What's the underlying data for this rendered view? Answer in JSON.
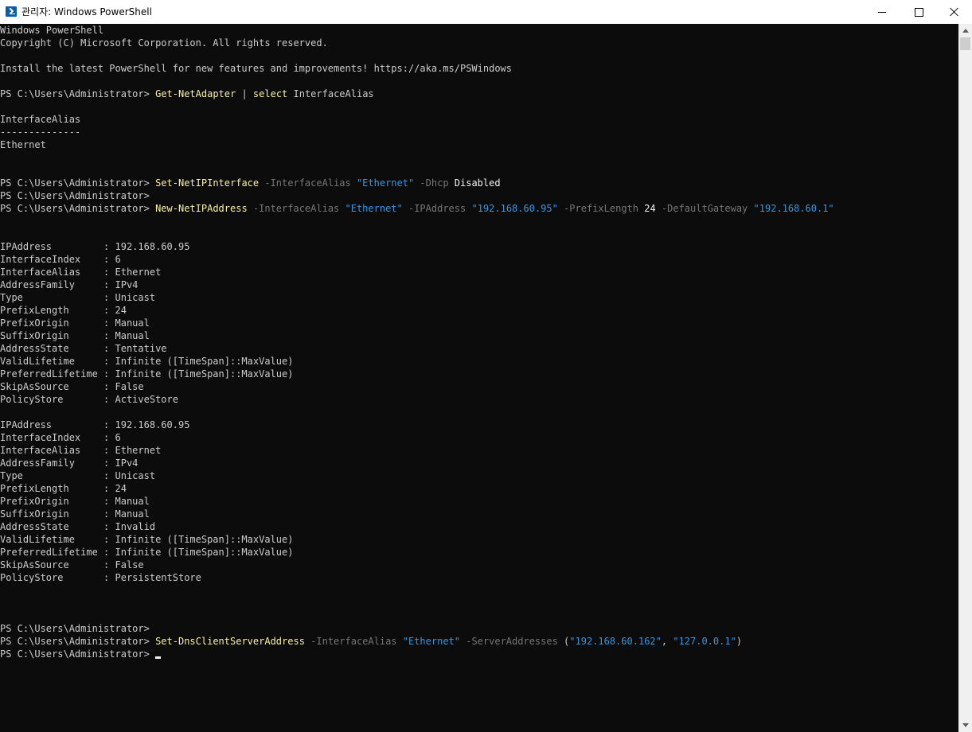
{
  "window": {
    "title": "관리자: Windows PowerShell",
    "icon": "powershell-icon",
    "controls": [
      "minimize-icon",
      "maximize-icon",
      "close-icon"
    ]
  },
  "colors": {
    "background": "#0c0c0c",
    "default_text": "#cccccc",
    "command": "#f9f1a5",
    "parameter": "#767676",
    "string": "#3a96dd",
    "number": "#f2f2f2"
  },
  "console": {
    "lines": [
      [
        {
          "t": "Windows PowerShell",
          "c": "default"
        }
      ],
      [
        {
          "t": "Copyright (C) Microsoft Corporation. All rights reserved.",
          "c": "default"
        }
      ],
      [],
      [
        {
          "t": "Install the latest PowerShell for new features and improvements! https://aka.ms/PSWindows",
          "c": "default"
        }
      ],
      [],
      [
        {
          "t": "PS C:\\Users\\Administrator> ",
          "c": "default"
        },
        {
          "t": "Get-NetAdapter",
          "c": "cmd"
        },
        {
          "t": " | ",
          "c": "op"
        },
        {
          "t": "select",
          "c": "cmd"
        },
        {
          "t": " InterfaceAlias",
          "c": "default"
        }
      ],
      [],
      [
        {
          "t": "InterfaceAlias",
          "c": "default"
        }
      ],
      [
        {
          "t": "--------------",
          "c": "default"
        }
      ],
      [
        {
          "t": "Ethernet",
          "c": "default"
        }
      ],
      [],
      [],
      [
        {
          "t": "PS C:\\Users\\Administrator> ",
          "c": "default"
        },
        {
          "t": "Set-NetIPInterface",
          "c": "cmd"
        },
        {
          "t": " -InterfaceAlias",
          "c": "param"
        },
        {
          "t": " ",
          "c": "default"
        },
        {
          "t": "\"Ethernet\"",
          "c": "str"
        },
        {
          "t": " -Dhcp",
          "c": "param"
        },
        {
          "t": " Disabled",
          "c": "arg"
        }
      ],
      [
        {
          "t": "PS C:\\Users\\Administrator>",
          "c": "default"
        }
      ],
      [
        {
          "t": "PS C:\\Users\\Administrator> ",
          "c": "default"
        },
        {
          "t": "New-NetIPAddress",
          "c": "cmd"
        },
        {
          "t": " -InterfaceAlias",
          "c": "param"
        },
        {
          "t": " ",
          "c": "default"
        },
        {
          "t": "\"Ethernet\"",
          "c": "str"
        },
        {
          "t": " -IPAddress",
          "c": "param"
        },
        {
          "t": " ",
          "c": "default"
        },
        {
          "t": "\"192.168.60.95\"",
          "c": "str"
        },
        {
          "t": " -PrefixLength",
          "c": "param"
        },
        {
          "t": " 24",
          "c": "num"
        },
        {
          "t": " -DefaultGateway",
          "c": "param"
        },
        {
          "t": " ",
          "c": "default"
        },
        {
          "t": "\"192.168.60.1\"",
          "c": "str"
        }
      ],
      [],
      [],
      [
        {
          "t": "IPAddress         : 192.168.60.95",
          "c": "default"
        }
      ],
      [
        {
          "t": "InterfaceIndex    : 6",
          "c": "default"
        }
      ],
      [
        {
          "t": "InterfaceAlias    : Ethernet",
          "c": "default"
        }
      ],
      [
        {
          "t": "AddressFamily     : IPv4",
          "c": "default"
        }
      ],
      [
        {
          "t": "Type              : Unicast",
          "c": "default"
        }
      ],
      [
        {
          "t": "PrefixLength      : 24",
          "c": "default"
        }
      ],
      [
        {
          "t": "PrefixOrigin      : Manual",
          "c": "default"
        }
      ],
      [
        {
          "t": "SuffixOrigin      : Manual",
          "c": "default"
        }
      ],
      [
        {
          "t": "AddressState      : Tentative",
          "c": "default"
        }
      ],
      [
        {
          "t": "ValidLifetime     : Infinite ([TimeSpan]::MaxValue)",
          "c": "default"
        }
      ],
      [
        {
          "t": "PreferredLifetime : Infinite ([TimeSpan]::MaxValue)",
          "c": "default"
        }
      ],
      [
        {
          "t": "SkipAsSource      : False",
          "c": "default"
        }
      ],
      [
        {
          "t": "PolicyStore       : ActiveStore",
          "c": "default"
        }
      ],
      [],
      [
        {
          "t": "IPAddress         : 192.168.60.95",
          "c": "default"
        }
      ],
      [
        {
          "t": "InterfaceIndex    : 6",
          "c": "default"
        }
      ],
      [
        {
          "t": "InterfaceAlias    : Ethernet",
          "c": "default"
        }
      ],
      [
        {
          "t": "AddressFamily     : IPv4",
          "c": "default"
        }
      ],
      [
        {
          "t": "Type              : Unicast",
          "c": "default"
        }
      ],
      [
        {
          "t": "PrefixLength      : 24",
          "c": "default"
        }
      ],
      [
        {
          "t": "PrefixOrigin      : Manual",
          "c": "default"
        }
      ],
      [
        {
          "t": "SuffixOrigin      : Manual",
          "c": "default"
        }
      ],
      [
        {
          "t": "AddressState      : Invalid",
          "c": "default"
        }
      ],
      [
        {
          "t": "ValidLifetime     : Infinite ([TimeSpan]::MaxValue)",
          "c": "default"
        }
      ],
      [
        {
          "t": "PreferredLifetime : Infinite ([TimeSpan]::MaxValue)",
          "c": "default"
        }
      ],
      [
        {
          "t": "SkipAsSource      : False",
          "c": "default"
        }
      ],
      [
        {
          "t": "PolicyStore       : PersistentStore",
          "c": "default"
        }
      ],
      [],
      [],
      [],
      [
        {
          "t": "PS C:\\Users\\Administrator>",
          "c": "default"
        }
      ],
      [
        {
          "t": "PS C:\\Users\\Administrator> ",
          "c": "default"
        },
        {
          "t": "Set-DnsClientServerAddress",
          "c": "cmd"
        },
        {
          "t": " -InterfaceAlias",
          "c": "param"
        },
        {
          "t": " ",
          "c": "default"
        },
        {
          "t": "\"Ethernet\"",
          "c": "str"
        },
        {
          "t": " -ServerAddresses",
          "c": "param"
        },
        {
          "t": " (",
          "c": "op"
        },
        {
          "t": "\"192.168.60.162\"",
          "c": "str"
        },
        {
          "t": ", ",
          "c": "op"
        },
        {
          "t": "\"127.0.0.1\"",
          "c": "str"
        },
        {
          "t": ")",
          "c": "op"
        }
      ],
      [
        {
          "t": "PS C:\\Users\\Administrator> ",
          "c": "default"
        },
        {
          "t": "",
          "c": "cursor"
        }
      ]
    ]
  }
}
